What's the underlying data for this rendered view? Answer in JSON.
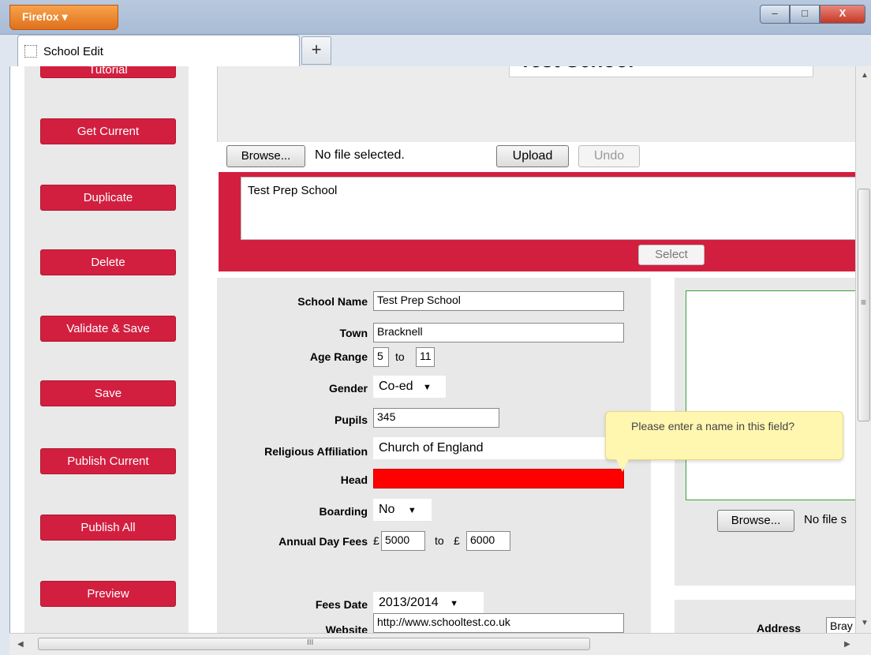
{
  "browser": {
    "menu_label": "Firefox",
    "tab_title": "School Edit",
    "new_tab": "+",
    "minimize": "–",
    "maximize": "□",
    "close": "X"
  },
  "sidebar": {
    "partial_top": "Tutorial",
    "buttons": [
      {
        "label": "Get Current"
      },
      {
        "label": "Duplicate"
      },
      {
        "label": "Delete"
      },
      {
        "label": "Validate & Save"
      },
      {
        "label": "Save"
      },
      {
        "label": "Publish Current"
      },
      {
        "label": "Publish All"
      },
      {
        "label": "Preview"
      }
    ]
  },
  "header": {
    "school_title": "Test School",
    "browse_label": "Browse...",
    "file_status": "No file selected.",
    "upload_label": "Upload",
    "undo_label": "Undo"
  },
  "name_panel": {
    "text": "Test Prep School",
    "select_label": "Select"
  },
  "form": {
    "school_name": {
      "label": "School Name",
      "value": "Test Prep School"
    },
    "town": {
      "label": "Town",
      "value": "Bracknell"
    },
    "age_range": {
      "label": "Age Range",
      "from": "5",
      "to_word": "to",
      "to": "11"
    },
    "gender": {
      "label": "Gender",
      "value": "Co-ed"
    },
    "pupils": {
      "label": "Pupils",
      "value": "345"
    },
    "religion": {
      "label": "Religious Affiliation",
      "value": "Church of England"
    },
    "head": {
      "label": "Head",
      "value": "",
      "error_color": "#ff0000"
    },
    "boarding": {
      "label": "Boarding",
      "value": "No"
    },
    "fees": {
      "label": "Annual Day Fees",
      "currency": "£",
      "from": "5000",
      "to_word": "to",
      "to": "6000"
    },
    "fees_date": {
      "label": "Fees Date",
      "value": "2013/2014"
    },
    "website": {
      "label": "Website",
      "value": "http://www.schooltest.co.uk"
    }
  },
  "tooltip": {
    "text": "Please enter a name in this field?"
  },
  "right": {
    "browse_label": "Browse...",
    "file_status": "No file s",
    "address_label": "Address",
    "address_value": "Bray"
  },
  "scroll": {
    "grip": "III",
    "vgrip": "≡"
  },
  "colors": {
    "accent": "#d21f40",
    "image_border": "#3aa13a",
    "tooltip_bg": "#fff6b0"
  }
}
